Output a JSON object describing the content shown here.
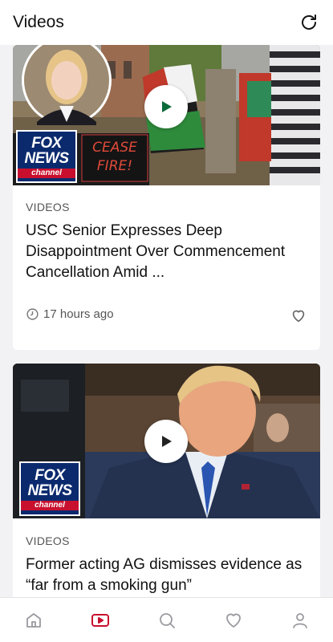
{
  "header": {
    "title": "Videos"
  },
  "feed": {
    "cards": [
      {
        "category": "VIDEOS",
        "headline": "USC Senior Expresses Deep Disappointment Over Commencement Cancellation Amid ...",
        "time": "17 hours ago",
        "logo": {
          "line1": "FOX",
          "line2": "NEWS",
          "line3": "channel"
        },
        "sign_text": "CEASE FIRE!"
      },
      {
        "category": "VIDEOS",
        "headline": "Former acting AG dismisses evidence as “far from a smoking gun”",
        "logo": {
          "line1": "FOX",
          "line2": "NEWS",
          "line3": "channel"
        }
      }
    ]
  },
  "tabbar": {
    "items": [
      {
        "icon": "home-icon",
        "active": false
      },
      {
        "icon": "video-icon",
        "active": true
      },
      {
        "icon": "search-icon",
        "active": false
      },
      {
        "icon": "heart-icon",
        "active": false
      },
      {
        "icon": "profile-icon",
        "active": false
      }
    ]
  },
  "colors": {
    "accent": "#c8102e",
    "inactive_icon": "#9a9aa0",
    "fox_blue": "#0b2a6e"
  }
}
